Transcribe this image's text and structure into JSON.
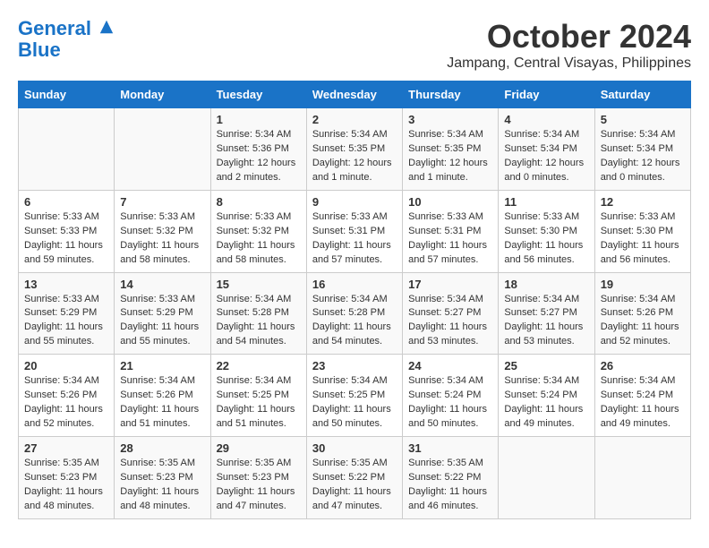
{
  "header": {
    "logo_line1": "General",
    "logo_line2": "Blue",
    "month": "October 2024",
    "location": "Jampang, Central Visayas, Philippines"
  },
  "days_of_week": [
    "Sunday",
    "Monday",
    "Tuesday",
    "Wednesday",
    "Thursday",
    "Friday",
    "Saturday"
  ],
  "weeks": [
    [
      {
        "day": "",
        "info": ""
      },
      {
        "day": "",
        "info": ""
      },
      {
        "day": "1",
        "info": "Sunrise: 5:34 AM\nSunset: 5:36 PM\nDaylight: 12 hours\nand 2 minutes."
      },
      {
        "day": "2",
        "info": "Sunrise: 5:34 AM\nSunset: 5:35 PM\nDaylight: 12 hours\nand 1 minute."
      },
      {
        "day": "3",
        "info": "Sunrise: 5:34 AM\nSunset: 5:35 PM\nDaylight: 12 hours\nand 1 minute."
      },
      {
        "day": "4",
        "info": "Sunrise: 5:34 AM\nSunset: 5:34 PM\nDaylight: 12 hours\nand 0 minutes."
      },
      {
        "day": "5",
        "info": "Sunrise: 5:34 AM\nSunset: 5:34 PM\nDaylight: 12 hours\nand 0 minutes."
      }
    ],
    [
      {
        "day": "6",
        "info": "Sunrise: 5:33 AM\nSunset: 5:33 PM\nDaylight: 11 hours\nand 59 minutes."
      },
      {
        "day": "7",
        "info": "Sunrise: 5:33 AM\nSunset: 5:32 PM\nDaylight: 11 hours\nand 58 minutes."
      },
      {
        "day": "8",
        "info": "Sunrise: 5:33 AM\nSunset: 5:32 PM\nDaylight: 11 hours\nand 58 minutes."
      },
      {
        "day": "9",
        "info": "Sunrise: 5:33 AM\nSunset: 5:31 PM\nDaylight: 11 hours\nand 57 minutes."
      },
      {
        "day": "10",
        "info": "Sunrise: 5:33 AM\nSunset: 5:31 PM\nDaylight: 11 hours\nand 57 minutes."
      },
      {
        "day": "11",
        "info": "Sunrise: 5:33 AM\nSunset: 5:30 PM\nDaylight: 11 hours\nand 56 minutes."
      },
      {
        "day": "12",
        "info": "Sunrise: 5:33 AM\nSunset: 5:30 PM\nDaylight: 11 hours\nand 56 minutes."
      }
    ],
    [
      {
        "day": "13",
        "info": "Sunrise: 5:33 AM\nSunset: 5:29 PM\nDaylight: 11 hours\nand 55 minutes."
      },
      {
        "day": "14",
        "info": "Sunrise: 5:33 AM\nSunset: 5:29 PM\nDaylight: 11 hours\nand 55 minutes."
      },
      {
        "day": "15",
        "info": "Sunrise: 5:34 AM\nSunset: 5:28 PM\nDaylight: 11 hours\nand 54 minutes."
      },
      {
        "day": "16",
        "info": "Sunrise: 5:34 AM\nSunset: 5:28 PM\nDaylight: 11 hours\nand 54 minutes."
      },
      {
        "day": "17",
        "info": "Sunrise: 5:34 AM\nSunset: 5:27 PM\nDaylight: 11 hours\nand 53 minutes."
      },
      {
        "day": "18",
        "info": "Sunrise: 5:34 AM\nSunset: 5:27 PM\nDaylight: 11 hours\nand 53 minutes."
      },
      {
        "day": "19",
        "info": "Sunrise: 5:34 AM\nSunset: 5:26 PM\nDaylight: 11 hours\nand 52 minutes."
      }
    ],
    [
      {
        "day": "20",
        "info": "Sunrise: 5:34 AM\nSunset: 5:26 PM\nDaylight: 11 hours\nand 52 minutes."
      },
      {
        "day": "21",
        "info": "Sunrise: 5:34 AM\nSunset: 5:26 PM\nDaylight: 11 hours\nand 51 minutes."
      },
      {
        "day": "22",
        "info": "Sunrise: 5:34 AM\nSunset: 5:25 PM\nDaylight: 11 hours\nand 51 minutes."
      },
      {
        "day": "23",
        "info": "Sunrise: 5:34 AM\nSunset: 5:25 PM\nDaylight: 11 hours\nand 50 minutes."
      },
      {
        "day": "24",
        "info": "Sunrise: 5:34 AM\nSunset: 5:24 PM\nDaylight: 11 hours\nand 50 minutes."
      },
      {
        "day": "25",
        "info": "Sunrise: 5:34 AM\nSunset: 5:24 PM\nDaylight: 11 hours\nand 49 minutes."
      },
      {
        "day": "26",
        "info": "Sunrise: 5:34 AM\nSunset: 5:24 PM\nDaylight: 11 hours\nand 49 minutes."
      }
    ],
    [
      {
        "day": "27",
        "info": "Sunrise: 5:35 AM\nSunset: 5:23 PM\nDaylight: 11 hours\nand 48 minutes."
      },
      {
        "day": "28",
        "info": "Sunrise: 5:35 AM\nSunset: 5:23 PM\nDaylight: 11 hours\nand 48 minutes."
      },
      {
        "day": "29",
        "info": "Sunrise: 5:35 AM\nSunset: 5:23 PM\nDaylight: 11 hours\nand 47 minutes."
      },
      {
        "day": "30",
        "info": "Sunrise: 5:35 AM\nSunset: 5:22 PM\nDaylight: 11 hours\nand 47 minutes."
      },
      {
        "day": "31",
        "info": "Sunrise: 5:35 AM\nSunset: 5:22 PM\nDaylight: 11 hours\nand 46 minutes."
      },
      {
        "day": "",
        "info": ""
      },
      {
        "day": "",
        "info": ""
      }
    ]
  ]
}
